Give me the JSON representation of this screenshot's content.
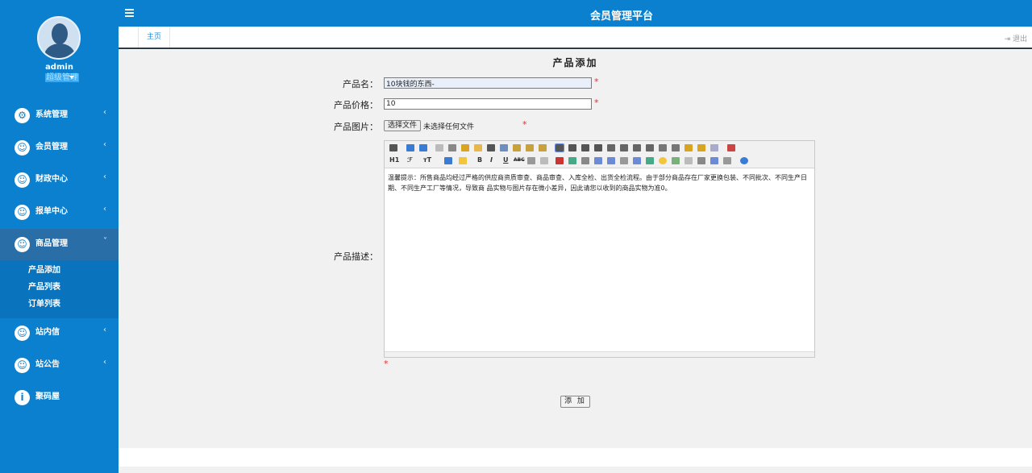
{
  "app_title": "会员管理平台",
  "user": {
    "name": "admin",
    "role": "超级管理"
  },
  "sidebar": {
    "items": [
      {
        "label": "系统管理",
        "icon": "gear-icon"
      },
      {
        "label": "会员管理",
        "icon": "user-icon"
      },
      {
        "label": "财政中心",
        "icon": "user-icon"
      },
      {
        "label": "报单中心",
        "icon": "user-icon"
      },
      {
        "label": "商品管理",
        "icon": "user-icon"
      },
      {
        "label": "站内信",
        "icon": "user-icon"
      },
      {
        "label": "站公告",
        "icon": "user-icon"
      },
      {
        "label": "聚码屋",
        "icon": "info-icon"
      }
    ],
    "submenu": [
      "产品添加",
      "产品列表",
      "订单列表"
    ]
  },
  "tabs": {
    "home": "主页",
    "logout": "退出"
  },
  "form": {
    "title": "产品添加",
    "name_label": "产品名：",
    "name_value": "10块钱的东西-",
    "price_label": "产品价格：",
    "price_value": "10",
    "image_label": "产品图片：",
    "file_button": "选择文件",
    "file_status": "未选择任何文件",
    "desc_label": "产品描述：",
    "required_mark": "*",
    "editor_text": "温馨提示：所售商品均经过严格的供应商资质审查、商品审查、入库全检、出货全检流程。由于部分商品存在厂家更换包装、不同批次、不同生产日期、不同生产工厂等情况，导致商 品实物与图片存在微小差异，因此请您以收到的商品实物为准0。",
    "submit": "添 加"
  },
  "toolbar": {
    "h1": "H1",
    "font": "ℱ",
    "size": "тT",
    "bold": "B",
    "italic": "I",
    "underline": "U",
    "strike": "ABC"
  },
  "colors": {
    "sidebar": "#0b80cf",
    "accent": "#1f8fd8",
    "required": "#e03030"
  }
}
